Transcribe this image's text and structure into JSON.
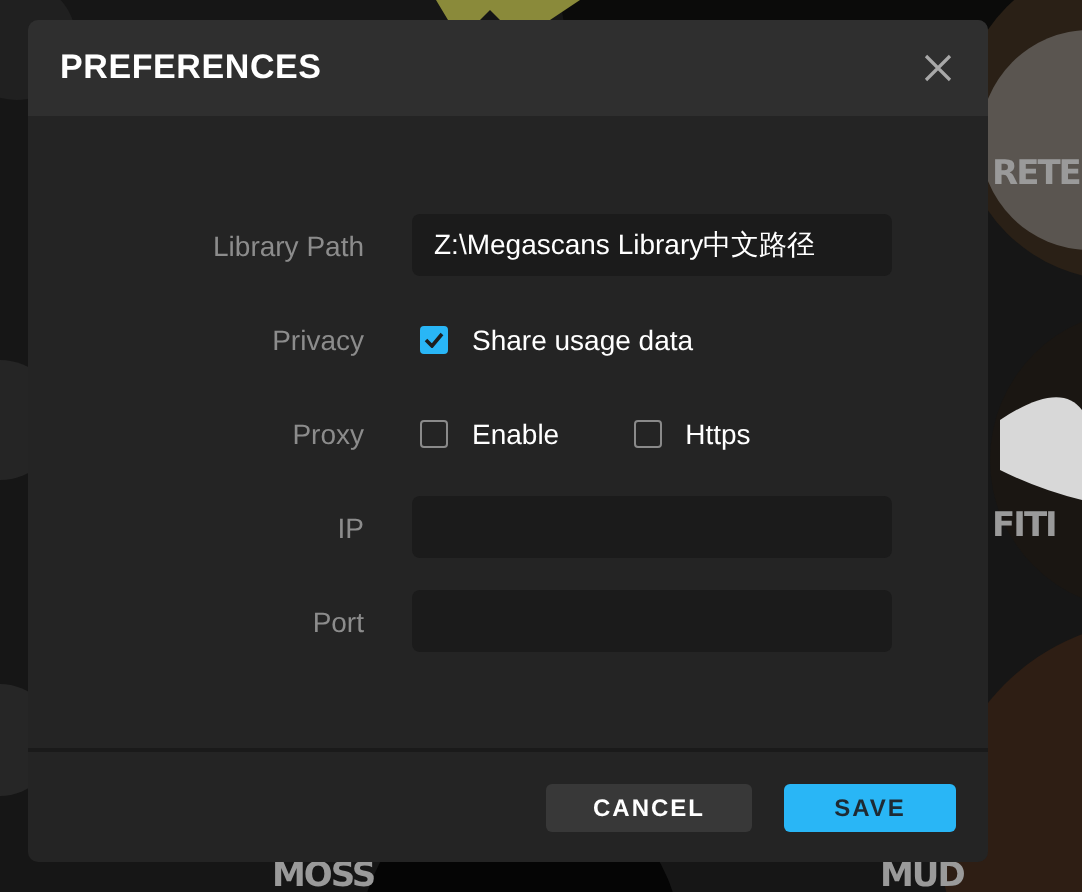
{
  "background_tiles": [
    {
      "label": "RETE"
    },
    {
      "label": "FITI"
    },
    {
      "label": "MOSS"
    },
    {
      "label": "MUD"
    }
  ],
  "dialog": {
    "title": "PREFERENCES",
    "fields": [
      {
        "kind": "text",
        "label": "Library Path",
        "value": "Z:\\Megascans Library中文路径"
      },
      {
        "kind": "checkboxes",
        "label": "Privacy",
        "options": [
          {
            "label": "Share usage data",
            "checked": true
          }
        ]
      },
      {
        "kind": "checkboxes",
        "label": "Proxy",
        "options": [
          {
            "label": "Enable",
            "checked": false
          },
          {
            "label": "Https",
            "checked": false
          }
        ]
      },
      {
        "kind": "text",
        "label": "IP"
      },
      {
        "kind": "text",
        "label": "Port"
      }
    ],
    "buttons": [
      {
        "label": "CANCEL",
        "kind": "secondary"
      },
      {
        "label": "SAVE",
        "kind": "primary"
      }
    ]
  }
}
